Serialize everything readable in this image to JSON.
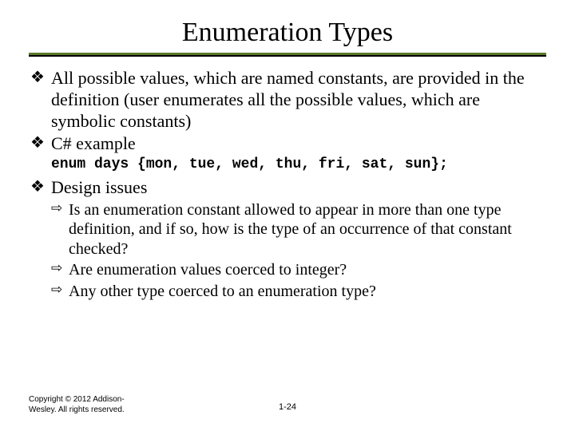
{
  "title": "Enumeration Types",
  "bullets": [
    {
      "text": "All possible values, which are named constants, are provided in the definition (user enumerates all the possible values, which are symbolic constants)"
    },
    {
      "text": "C# example",
      "code": "enum days {mon, tue, wed, thu, fri, sat, sun};"
    },
    {
      "text": "Design issues",
      "sub": [
        "Is an enumeration constant allowed to appear in more than one type definition, and if so, how is the type of an occurrence of that constant checked?",
        "Are enumeration values coerced to integer?",
        "Any other type coerced to an enumeration type?"
      ]
    }
  ],
  "footer": {
    "copyright": "Copyright © 2012 Addison-Wesley. All rights reserved.",
    "page": "1-24"
  }
}
